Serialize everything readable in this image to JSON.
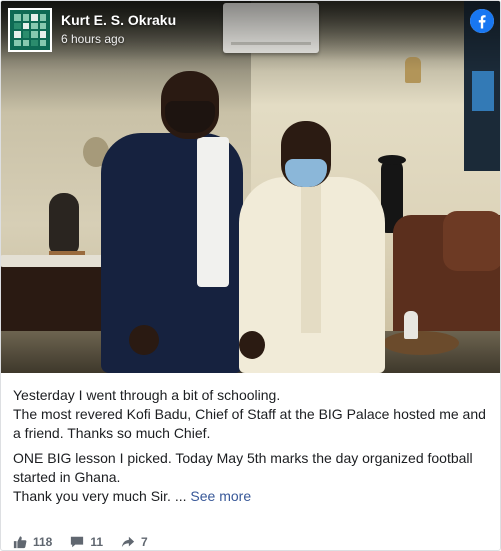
{
  "post": {
    "author": "Kurt E. S. Okraku",
    "timestamp": "6 hours ago",
    "caption": {
      "line1": "Yesterday I went through a bit of schooling.",
      "line2": "The most revered Kofi Badu, Chief of Staff at the BIG Palace hosted me and a friend. Thanks so much Chief.",
      "line3": "ONE BIG lesson I picked. Today May 5th marks the day organized football started in Ghana.",
      "line4_prefix": "Thank you very much Sir. ...",
      "see_more": "See more"
    },
    "stats": {
      "likes": "118",
      "comments": "11",
      "shares": "7"
    }
  },
  "icons": {
    "brand": "facebook-icon",
    "like": "thumbs-up-icon",
    "comment": "comment-icon",
    "share": "share-arrow-icon"
  },
  "colors": {
    "facebook_blue": "#1877f2",
    "link": "#385898",
    "meta_text": "#606770"
  }
}
